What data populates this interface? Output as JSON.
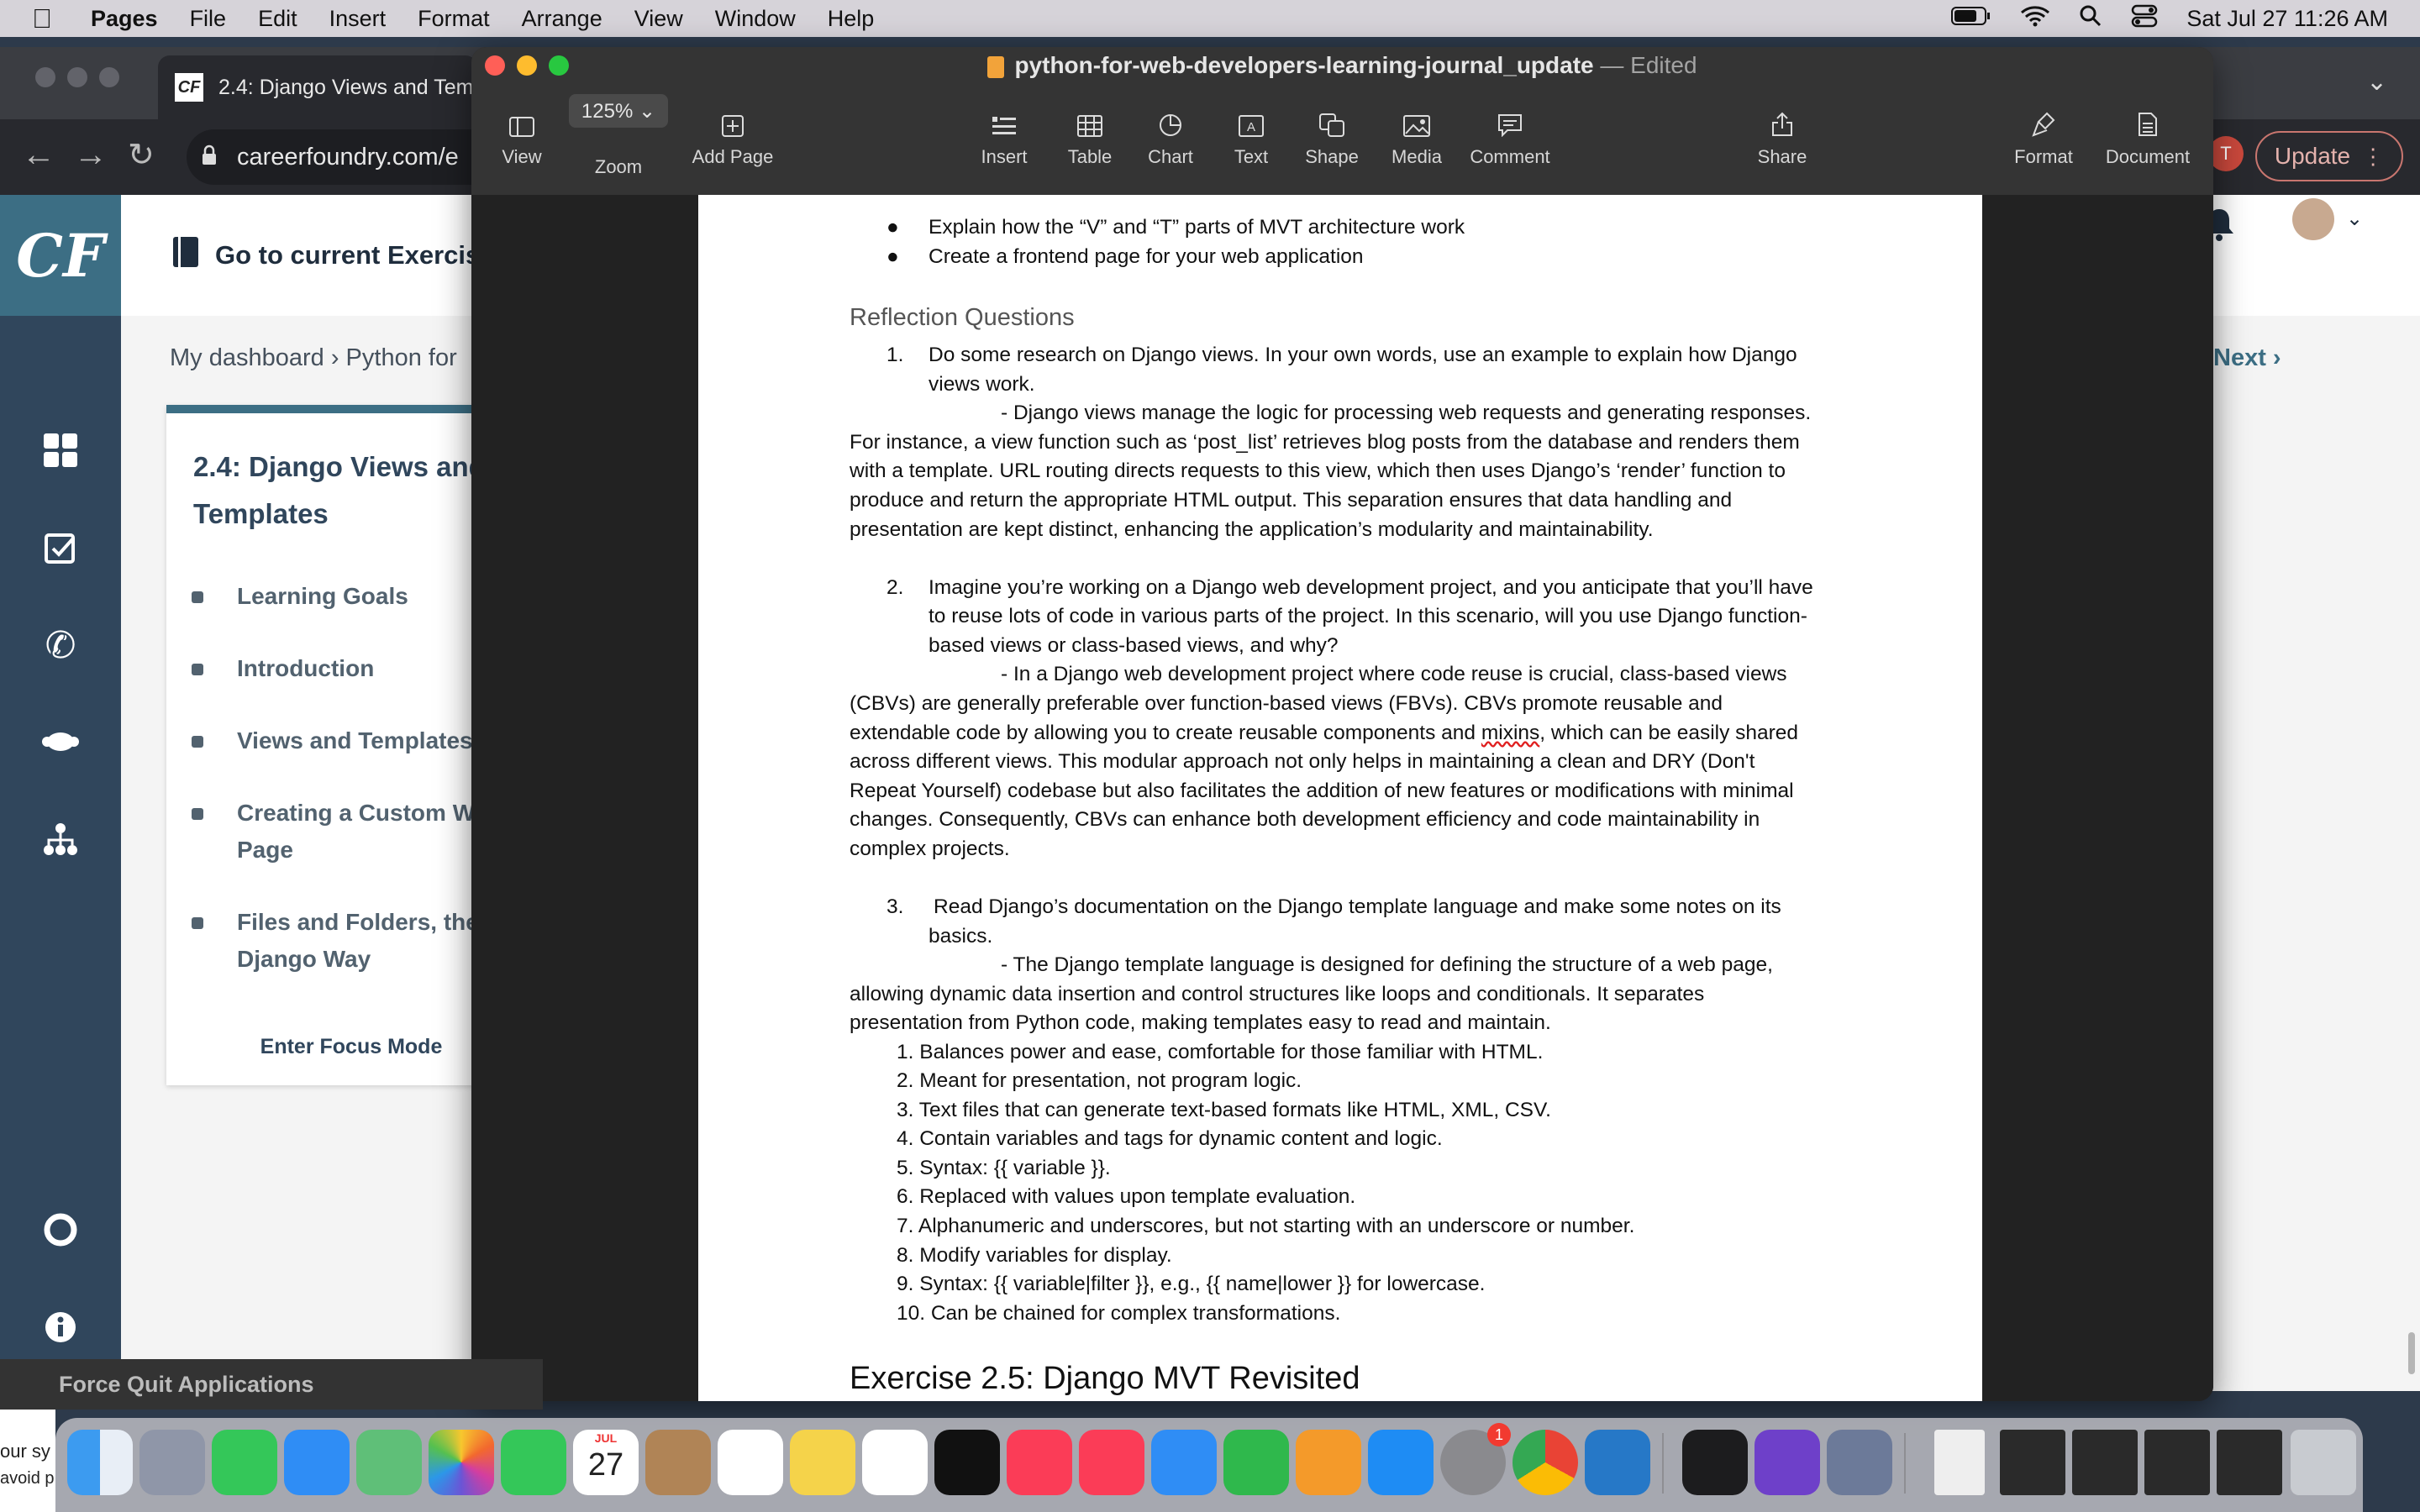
{
  "menubar": {
    "apple": "",
    "app": "Pages",
    "items": [
      "File",
      "Edit",
      "Insert",
      "Format",
      "Arrange",
      "View",
      "Window",
      "Help"
    ],
    "datetime": "Sat Jul 27  11:26 AM"
  },
  "browser": {
    "tab_title": "2.4: Django Views and Tem",
    "url": "careerfoundry.com/e",
    "update_label": "Update",
    "avatar_letter": "T"
  },
  "cf": {
    "logo": "CF",
    "goto_label": "Go to current Exercis",
    "breadcrumb": "My dashboard  ›  Python for",
    "next_label": "Next  ›",
    "lesson_title": "2.4: Django Views and Templates",
    "lesson_items": [
      "Learning Goals",
      "Introduction",
      "Views and Templates",
      "Creating a Custom Welcome Page",
      "Files and Folders, the Django Way"
    ],
    "focus_mode": "Enter Focus Mode"
  },
  "pages": {
    "doc_name": "python-for-web-developers-learning-journal_update",
    "doc_status": "— Edited",
    "zoom_value": "125% ⌄",
    "toolbar": {
      "view": "View",
      "zoom": "Zoom",
      "add_page": "Add Page",
      "insert": "Insert",
      "table": "Table",
      "chart": "Chart",
      "text": "Text",
      "shape": "Shape",
      "media": "Media",
      "comment": "Comment",
      "share": "Share",
      "format": "Format",
      "document": "Document"
    },
    "doc": {
      "bullet1": "Explain how the “V” and “T” parts of MVT architecture work",
      "bullet2": "Create a frontend page for your web application",
      "heading": "Reflection Questions",
      "q1_num": "1.",
      "q1_l1": "Do some research on Django views. In your own words, use an example to explain how Django",
      "q1_l2": "views work.",
      "a1_l1": "- Django views manage the logic for processing web requests and generating responses.",
      "a1_l2": "For instance, a view function such as ‘post_list’ retrieves blog posts from the database and renders them",
      "a1_l3": "with a template. URL routing directs requests to this view, which then uses Django’s ‘render’ function to",
      "a1_l4": "produce and return the appropriate HTML output. This separation ensures that data handling and",
      "a1_l5": "presentation are kept distinct, enhancing the application’s modularity and maintainability.",
      "q2_num": "2.",
      "q2_l1": "Imagine you’re working on a Django web development project, and you anticipate that you’ll have",
      "q2_l2": "to reuse lots of code in various parts of the project. In this scenario, will you use Django function-",
      "q2_l3": "based views or class-based views, and why?",
      "a2_l1": "- In a Django web development project where code reuse is crucial, class-based views",
      "a2_l2": "(CBVs) are generally preferable over function-based views (FBVs). CBVs promote reusable and",
      "a2_l3a": "extendable code by allowing you to create reusable components and ",
      "a2_l3b": "mixins",
      "a2_l3c": ", which can be easily shared",
      "a2_l4": "across different views. This modular approach not only helps in maintaining a clean and DRY (Don't",
      "a2_l5": "Repeat Yourself) codebase but also facilitates the addition of new features or modifications with minimal",
      "a2_l6": "changes. Consequently, CBVs can enhance both development efficiency and code maintainability in",
      "a2_l7": "complex projects.",
      "q3_num": "3.",
      "q3_l1": "Read Django’s documentation on the Django template language and make some notes on its",
      "q3_l2": "basics.",
      "a3_l1": "- The Django template language is designed for defining the structure of a web page,",
      "a3_l2": "allowing dynamic data insertion and control structures like loops and conditionals. It separates",
      "a3_l3": "presentation from Python code, making templates easy to read and maintain.",
      "notes": [
        "1.  Balances power and ease, comfortable for those familiar with HTML.",
        "2.  Meant for presentation, not program logic.",
        "3.  Text files that can generate text-based formats like HTML, XML, CSV.",
        "4.  Contain variables and tags for dynamic content and logic.",
        "5.  Syntax: {{ variable }}.",
        "6.  Replaced with values upon template evaluation.",
        "7.  Alphanumeric and underscores, but not starting with an underscore or number.",
        "8.  Modify variables for display.",
        "9.  Syntax: {{ variable|filter }}, e.g., {{ name|lower }} for lowercase.",
        "10.  Can be chained for complex transformations."
      ],
      "exercise_heading": "Exercise 2.5: Django MVT Revisited"
    }
  },
  "dock": {
    "force_quit": "Force Quit Applications",
    "calendar_month": "JUL",
    "calendar_day": "27",
    "settings_badge": "1",
    "left_fragment": "our sy",
    "left_fragment2": "avoid p"
  }
}
